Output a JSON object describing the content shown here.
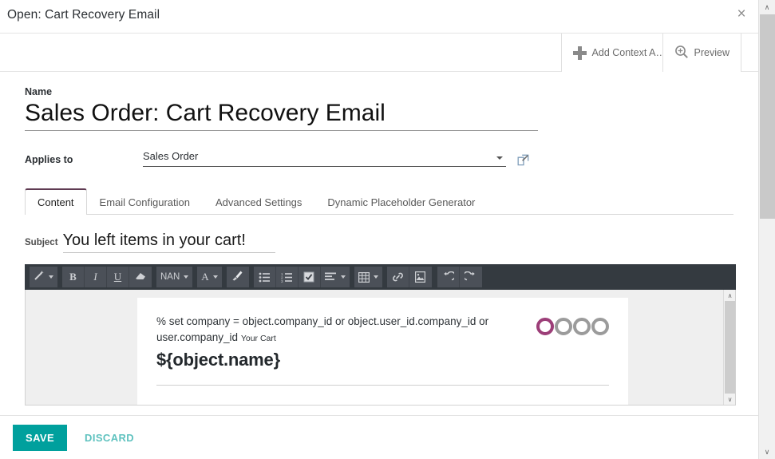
{
  "dialog": {
    "title": "Open: Cart Recovery Email",
    "close_icon": "close-icon",
    "close_glyph": "×"
  },
  "statusbar": {
    "buttons": [
      {
        "label": "Add Context A…",
        "icon": "plus-icon"
      },
      {
        "label": "Preview",
        "icon": "magnifier-plus-icon"
      }
    ]
  },
  "form": {
    "name_label": "Name",
    "name_value": "Sales Order: Cart Recovery Email",
    "applies_to_label": "Applies to",
    "applies_to_value": "Sales Order",
    "applies_to_placeholder": "Sales Order",
    "external_link_icon": "external-link-icon"
  },
  "notebook": {
    "tabs": [
      {
        "label": "Content",
        "active": true
      },
      {
        "label": "Email Configuration",
        "active": false
      },
      {
        "label": "Advanced Settings",
        "active": false
      },
      {
        "label": "Dynamic Placeholder Generator",
        "active": false
      }
    ]
  },
  "subject": {
    "label": "Subject",
    "value": "You left items in your cart!",
    "placeholder": "Subject"
  },
  "toolbar": {
    "groups": [
      {
        "items": [
          {
            "name": "magic-wand-button",
            "glyph": "✐",
            "caret": true
          }
        ]
      },
      {
        "items": [
          {
            "name": "bold-button",
            "glyph": "B",
            "bold": true
          },
          {
            "name": "italic-button",
            "glyph": "I",
            "italic": true
          },
          {
            "name": "underline-button",
            "glyph": "U",
            "underline": true
          },
          {
            "name": "remove-format-button",
            "glyph": "▰"
          }
        ]
      },
      {
        "items": [
          {
            "name": "font-size-select",
            "glyph": "NAN",
            "caret": true,
            "sans": true
          }
        ]
      },
      {
        "items": [
          {
            "name": "text-color-button",
            "glyph": "A",
            "caret": true
          }
        ]
      },
      {
        "items": [
          {
            "name": "background-color-button",
            "glyph": "✐"
          }
        ]
      },
      {
        "items": [
          {
            "name": "unordered-list-button",
            "glyph": "☰"
          },
          {
            "name": "ordered-list-button",
            "glyph": "☷"
          },
          {
            "name": "checklist-button",
            "glyph": "☑"
          },
          {
            "name": "align-button",
            "glyph": "≡",
            "caret": true
          }
        ]
      },
      {
        "items": [
          {
            "name": "table-button",
            "glyph": "⊞",
            "caret": true
          }
        ]
      },
      {
        "items": [
          {
            "name": "link-button",
            "glyph": "🔗"
          },
          {
            "name": "image-button",
            "glyph": "⛰"
          }
        ]
      },
      {
        "items": [
          {
            "name": "undo-button",
            "glyph": "↶"
          },
          {
            "name": "redo-button",
            "glyph": "↷"
          }
        ]
      }
    ]
  },
  "email_body": {
    "code_line": "% set company = object.company_id or object.user_id.company_id or user.company_id",
    "small_text": "Your Cart",
    "heading": "${object.name}",
    "logo_text": "odoo",
    "logo_brand_color": "#9c3e78",
    "logo_gray_color": "#9b9b9b"
  },
  "footer": {
    "save_label": "SAVE",
    "discard_label": "DISCARD",
    "save_color": "#00a09d"
  },
  "scrollbars": {
    "up_glyph": "∧",
    "down_glyph": "∨"
  }
}
